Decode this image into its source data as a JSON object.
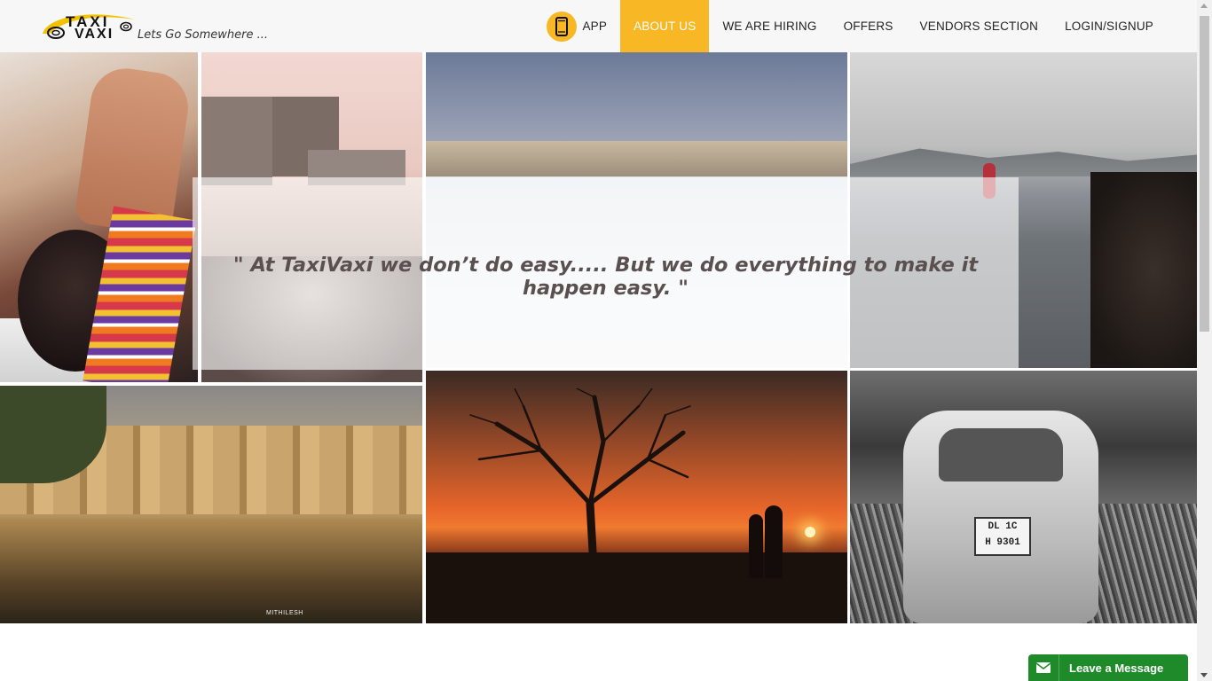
{
  "brand": {
    "logo_line1": "TAXI",
    "logo_line2": "VAXI",
    "tagline": "Lets Go Somewhere ...",
    "accent_color": "#f8b825"
  },
  "nav": {
    "items": [
      {
        "label": "APP",
        "icon": "mobile-phone-icon",
        "active": false
      },
      {
        "label": "ABOUT US",
        "active": true
      },
      {
        "label": "WE ARE HIRING",
        "active": false
      },
      {
        "label": "OFFERS",
        "active": false
      },
      {
        "label": "VENDORS SECTION",
        "active": false
      },
      {
        "label": "LOGIN/SIGNUP",
        "active": false
      }
    ]
  },
  "hero": {
    "quote": "\"    At TaxiVaxi we don’t do easy..... But we do everything to make it happen easy.     \"",
    "photo_credit": "MITHILESH",
    "car_plate_line1": "DL 1C",
    "car_plate_line2": "H 9301"
  },
  "chat_widget": {
    "label": "Leave a Message",
    "icon": "envelope-icon",
    "color": "#1e8a2a"
  }
}
